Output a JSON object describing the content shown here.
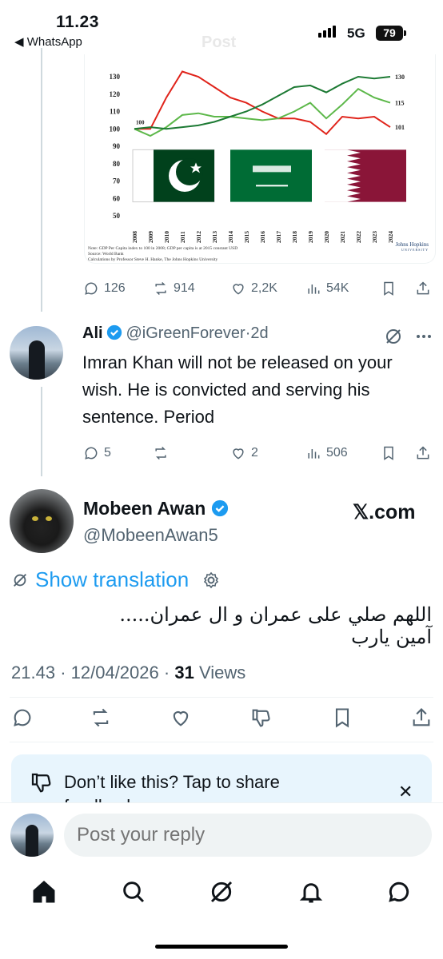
{
  "status_bar": {
    "time": "11.23",
    "back_app": "◀ WhatsApp",
    "network": "5G",
    "battery": "79"
  },
  "header": {
    "title_ghost": "Post"
  },
  "chart_image": {
    "chart_data": {
      "type": "line",
      "x": [
        "2008",
        "2009",
        "2010",
        "2011",
        "2012",
        "2013",
        "2014",
        "2015",
        "2016",
        "2017",
        "2018",
        "2019",
        "2020",
        "2021",
        "2022",
        "2023",
        "2024"
      ],
      "ylim": [
        50,
        130
      ],
      "yticks": [
        "130",
        "120",
        "110",
        "100",
        "90",
        "80",
        "70",
        "60",
        "50"
      ],
      "series": [
        {
          "color": "#e0241b",
          "values": [
            100,
            100,
            118,
            133,
            130,
            124,
            118,
            115,
            110,
            106,
            106,
            104,
            97,
            107,
            106,
            107,
            101
          ]
        },
        {
          "color": "#5db84a",
          "values": [
            100,
            96,
            101,
            108,
            109,
            107,
            107,
            106,
            105,
            106,
            110,
            115,
            106,
            114,
            123,
            118,
            115
          ]
        },
        {
          "color": "#1d7a34",
          "values": [
            100,
            101,
            100,
            101,
            102,
            104,
            107,
            110,
            114,
            119,
            124,
            125,
            121,
            126,
            130,
            129,
            130
          ]
        }
      ],
      "annotations": [
        "100",
        "130",
        "115",
        "101"
      ]
    },
    "note": "Note: GDP Per Capita index to 100 in 2008; GDP per capita is at 2015 constant USD",
    "source": "Source: World Bank",
    "calc": "Calculations by Professor Steve H. Hanke, The Johns Hopkins University",
    "logo_text": "Johns Hopkins",
    "logo_sub": "UNIVERSITY"
  },
  "chart_tweet_stats": {
    "replies": "126",
    "reposts": "914",
    "likes": "2,2K",
    "views": "54K"
  },
  "reply_tweet": {
    "name": "Ali",
    "handle": "@iGreenForever",
    "dot": "·",
    "age": "2d",
    "text": "Imran Khan will not be released on your wish. He is convicted and serving his sentence. Period",
    "stats": {
      "replies": "5",
      "likes": "2",
      "views": "506"
    }
  },
  "main_tweet": {
    "name": "Mobeen Awan",
    "handle": "@MobeenAwan5",
    "watermark": "𝕏.com",
    "show_translation": "Show translation",
    "text": "اللهم صلي على عمران و ال عمران..... آمين يارب",
    "time": "21.43",
    "date": "12/04/2026",
    "views_count": "31",
    "views_label": "Views"
  },
  "feedback": {
    "text": "Don’t like this? Tap to share feedback",
    "close": "✕"
  },
  "reply_bar": {
    "placeholder": "Post your reply"
  },
  "colors": {
    "accent": "#1d9bf0",
    "muted": "#536471",
    "text": "#0f1419"
  }
}
